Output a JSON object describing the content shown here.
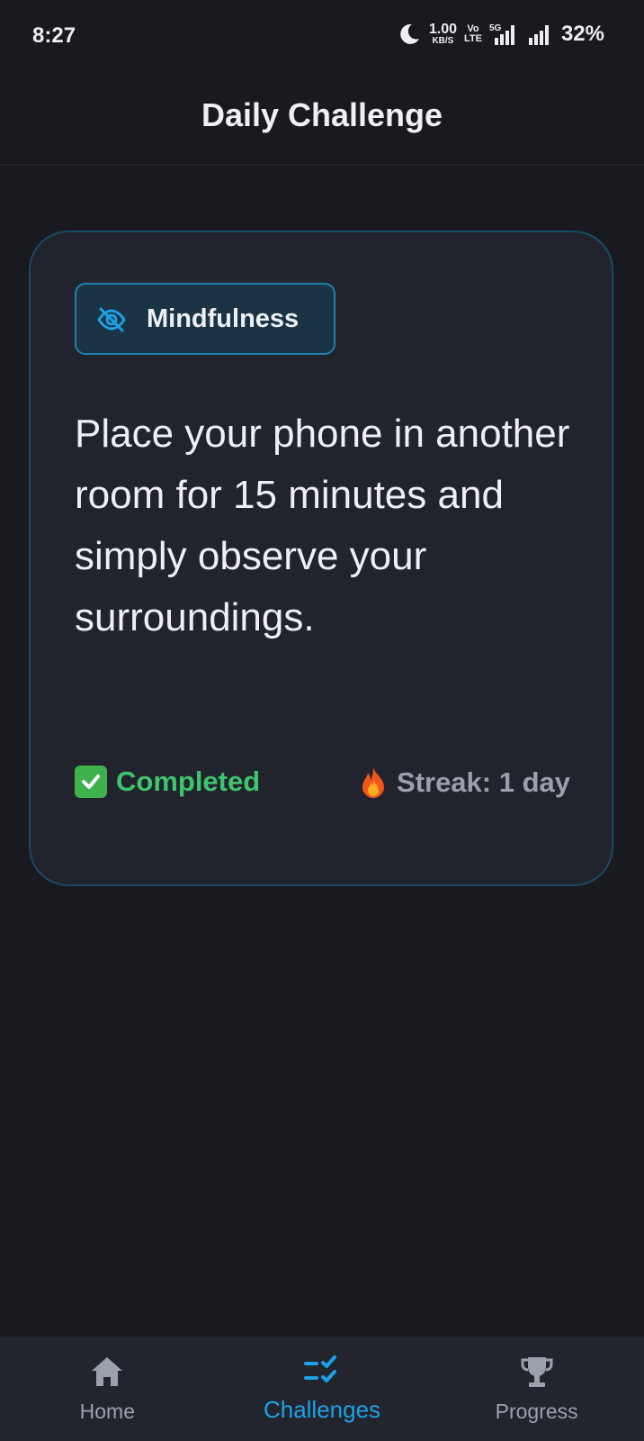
{
  "status_bar": {
    "time": "8:27",
    "net_speed_value": "1.00",
    "net_speed_unit": "KB/S",
    "volte_top": "Vo",
    "volte_bottom": "LTE",
    "network_type": "5G",
    "battery": "32%"
  },
  "header": {
    "title": "Daily Challenge"
  },
  "challenge_card": {
    "category": "Mindfulness",
    "category_icon": "eye-off-icon",
    "text": "Place your phone in another room for 15 minutes and simply observe your surroundings.",
    "status_icon": "check-icon",
    "status": "Completed",
    "streak_icon": "fire-icon",
    "streak": "Streak: 1 day"
  },
  "bottom_nav": {
    "items": [
      {
        "label": "Home",
        "icon": "home-icon",
        "active": false
      },
      {
        "label": "Challenges",
        "icon": "checklist-icon",
        "active": true
      },
      {
        "label": "Progress",
        "icon": "trophy-icon",
        "active": false
      }
    ]
  },
  "colors": {
    "background": "#181a20",
    "card": "#21242d",
    "card_border": "#1b4a62",
    "accent": "#1da1e6",
    "completed": "#3ec46d",
    "muted": "#9ba1ac"
  }
}
